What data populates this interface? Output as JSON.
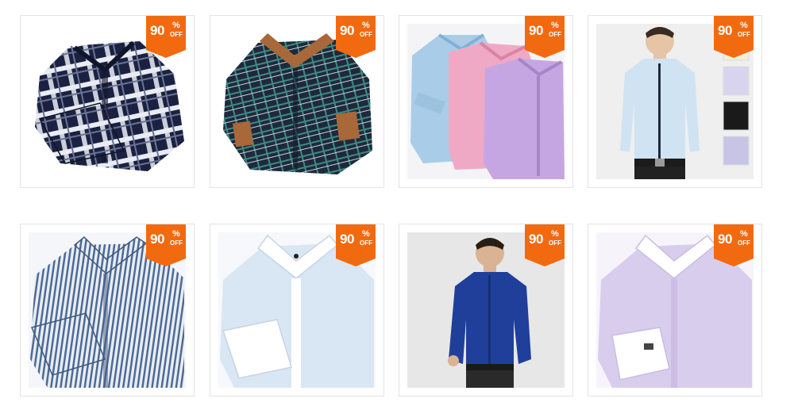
{
  "products": [
    {
      "name": "Navy and white plaid flannel shirt",
      "discount_number": "90",
      "discount_symbol": "%",
      "discount_word": "OFF"
    },
    {
      "name": "Dark navy checked shirt with brown trim",
      "discount_number": "90",
      "discount_symbol": "%",
      "discount_word": "OFF"
    },
    {
      "name": "Blue, pink and lavender oxford shirts",
      "discount_number": "90",
      "discount_symbol": "%",
      "discount_word": "OFF"
    },
    {
      "name": "Light blue slim fit shirt on model",
      "discount_number": "90",
      "discount_symbol": "%",
      "discount_word": "OFF"
    },
    {
      "name": "Blue and white striped shirt",
      "discount_number": "90",
      "discount_symbol": "%",
      "discount_word": "OFF"
    },
    {
      "name": "Pale blue shirt with white collar",
      "discount_number": "90",
      "discount_symbol": "%",
      "discount_word": "OFF"
    },
    {
      "name": "Royal blue shirt on model",
      "discount_number": "90",
      "discount_symbol": "%",
      "discount_word": "OFF"
    },
    {
      "name": "Lavender shirt with white collar and cufflinks",
      "discount_number": "90",
      "discount_symbol": "%",
      "discount_word": "OFF"
    }
  ],
  "colors": {
    "badge": "#f26a10",
    "card_border": "#e3e3e3"
  }
}
